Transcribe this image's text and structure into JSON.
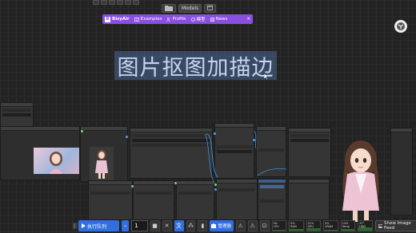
{
  "top_toolbar": {
    "folder_icon": "folder-icon",
    "models_label": "Models",
    "calendar_icon": "calendar-icon"
  },
  "bizy_bar": {
    "brand": "BizyAir",
    "items": [
      {
        "label": "Examples",
        "icon": "book-icon"
      },
      {
        "label": "Profile",
        "icon": "user-icon"
      },
      {
        "label": "模型",
        "icon": "cube-icon"
      },
      {
        "label": "News",
        "icon": "news-icon"
      }
    ],
    "close_glyph": "✕",
    "color": "#8a4fe0"
  },
  "canvas": {
    "title_text": "图片抠图加描边"
  },
  "bottom_bar": {
    "run_label": "执行队列",
    "run_count": "1",
    "manager_label": "管理器",
    "stats": [
      {
        "label": "CPU",
        "value": "0%",
        "fill": 0.05
      },
      {
        "label": "RAM",
        "value": "0%",
        "fill": 0.15
      },
      {
        "label": "GPU",
        "value": "21%",
        "fill": 0.21
      },
      {
        "label": "VRAM",
        "value": "0%",
        "fill": 0.05
      },
      {
        "label": "Temp",
        "value": "14%",
        "fill": 0.14
      },
      {
        "label": "HDD",
        "value": "37°",
        "fill": 0.37
      }
    ],
    "show_feed_label": "Show Image Feed",
    "accent": "#2f6fe0"
  }
}
